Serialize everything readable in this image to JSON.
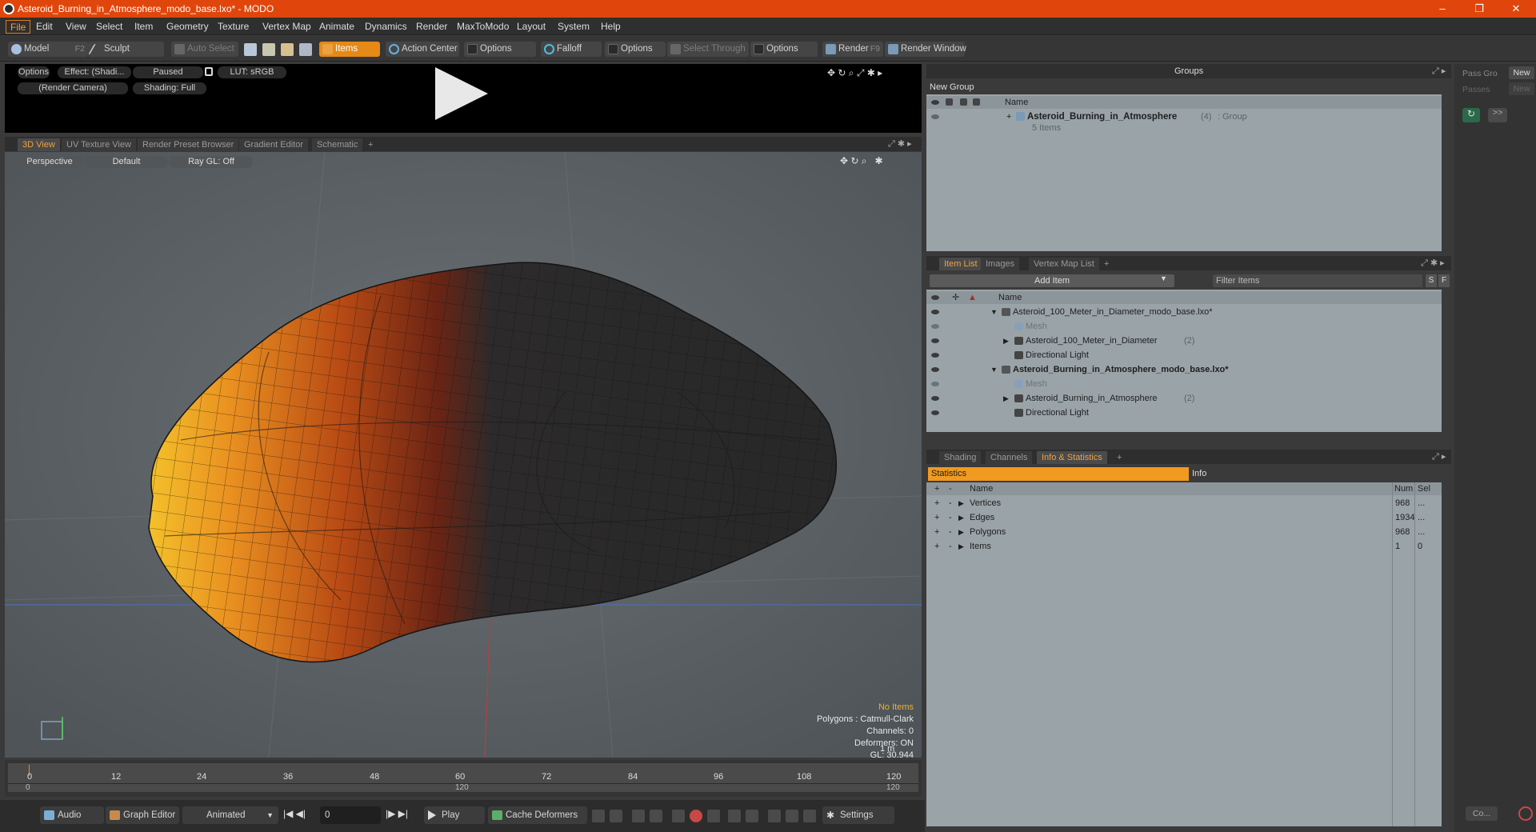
{
  "window": {
    "title": "Asteroid_Burning_in_Atmosphere_modo_base.lxo* - MODO",
    "minimize_glyph": "–",
    "maximize_glyph": "❐",
    "close_glyph": "✕"
  },
  "menu": [
    "File",
    "Edit",
    "View",
    "Select",
    "Item",
    "Geometry",
    "Texture",
    "Vertex Map",
    "Animate",
    "Dynamics",
    "Render",
    "MaxToModo",
    "Layout",
    "System",
    "Help"
  ],
  "toolbar": {
    "model": "Model",
    "model_key": "F2",
    "sculpt": "Sculpt",
    "auto_select": "Auto Select",
    "items": "Items",
    "action_center": "Action Center",
    "options1": "Options",
    "falloff": "Falloff",
    "options2": "Options",
    "select_through": "Select Through",
    "options3": "Options",
    "render": "Render",
    "render_key": "F9",
    "render_window": "Render Window"
  },
  "preview": {
    "options": "Options",
    "effect": "Effect: (Shadi...",
    "paused": "Paused",
    "lut": "LUT: sRGB",
    "camera": "(Render Camera)",
    "shading": "Shading: Full"
  },
  "view_tabs": [
    "3D View",
    "UV Texture View",
    "Render Preset Browser",
    "Gradient Editor",
    "Schematic",
    "+"
  ],
  "viewport": {
    "perspective": "Perspective",
    "default": "Default",
    "raygl": "Ray GL: Off",
    "info_title": "No Items",
    "info_lines": [
      "Polygons : Catmull-Clark",
      "Channels: 0",
      "Deformers: ON",
      "GL: 30,944",
      "1 m"
    ]
  },
  "timeline": {
    "ticks": [
      "0",
      "12",
      "24",
      "36",
      "48",
      "60",
      "72",
      "84",
      "96",
      "108",
      "120"
    ],
    "sub_ticks": [
      "0",
      "120",
      "120"
    ]
  },
  "bottom": {
    "audio": "Audio",
    "graph_editor": "Graph Editor",
    "animated": "Animated",
    "frame": "0",
    "play": "Play",
    "cache_deformers": "Cache Deformers",
    "settings": "Settings"
  },
  "groups": {
    "title": "Groups",
    "new_group": "New Group",
    "col_name": "Name",
    "group_name": "Asteroid_Burning_in_Atmosphere",
    "group_count": "(4)",
    "group_type": ": Group",
    "group_items": "5 Items"
  },
  "pass": {
    "pass_label": "Pass Gro",
    "passes_label": "Passes",
    "new1": "New",
    "new2": "New",
    "arrows": ">>",
    "co": "Co..."
  },
  "item_tabs": [
    "Item List",
    "Images",
    "Vertex Map List",
    "+"
  ],
  "item_list": {
    "add_item": "Add Item",
    "filter": "Filter Items",
    "s": "S",
    "f": "F",
    "col_name": "Name",
    "rows": [
      {
        "name": "Asteroid_100_Meter_in_Diameter_modo_base.lxo*",
        "bold": false,
        "indent": 0,
        "count": ""
      },
      {
        "name": "Mesh",
        "bold": false,
        "indent": 2,
        "count": "",
        "dim": true
      },
      {
        "name": "Asteroid_100_Meter_in_Diameter",
        "bold": false,
        "indent": 2,
        "count": "(2)"
      },
      {
        "name": "Directional Light",
        "bold": false,
        "indent": 2,
        "count": ""
      },
      {
        "name": "Asteroid_Burning_in_Atmosphere_modo_base.lxo*",
        "bold": true,
        "indent": 0,
        "count": ""
      },
      {
        "name": "Mesh",
        "bold": false,
        "indent": 2,
        "count": "",
        "dim": true
      },
      {
        "name": "Asteroid_Burning_in_Atmosphere",
        "bold": false,
        "indent": 2,
        "count": "(2)"
      },
      {
        "name": "Directional Light",
        "bold": false,
        "indent": 2,
        "count": ""
      }
    ]
  },
  "stats_tabs": [
    "Shading",
    "Channels",
    "Info & Statistics",
    "+"
  ],
  "stats": {
    "statistics": "Statistics",
    "info": "Info",
    "plus": "+",
    "minus": "-",
    "col_name": "Name",
    "col_num": "Num",
    "col_sel": "Sel",
    "rows": [
      {
        "name": "Vertices",
        "num": "968",
        "sel": "..."
      },
      {
        "name": "Edges",
        "num": "1934",
        "sel": "..."
      },
      {
        "name": "Polygons",
        "num": "968",
        "sel": "..."
      },
      {
        "name": "Items",
        "num": "1",
        "sel": "0"
      }
    ]
  }
}
